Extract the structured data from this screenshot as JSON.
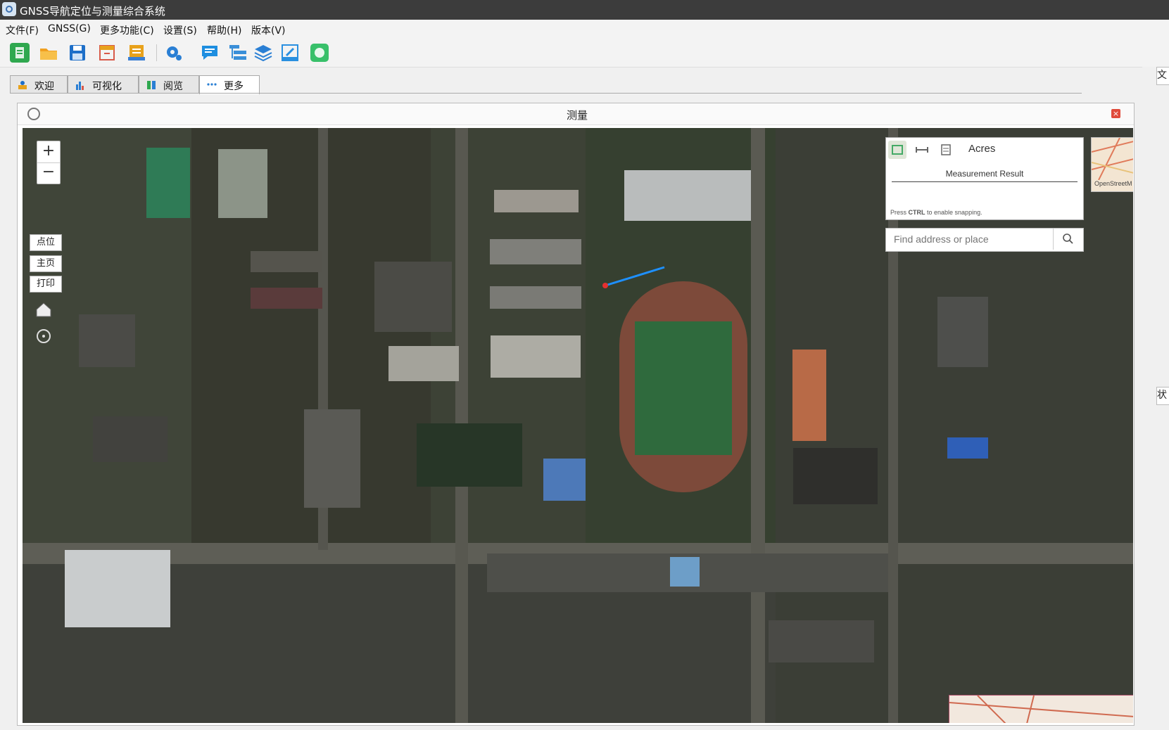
{
  "window": {
    "title": "GNSS导航定位与测量综合系统",
    "icon": "globe-app-icon"
  },
  "menu": [
    "文件(F)",
    "GNSS(G)",
    "更多功能(C)",
    "设置(S)",
    "帮助(H)",
    "版本(V)"
  ],
  "toolbar": {
    "buttons": [
      {
        "name": "new-file-icon",
        "color": "#2fa84f"
      },
      {
        "name": "open-folder-icon",
        "color": "#f0a020"
      },
      {
        "name": "save-icon",
        "color": "#1e6fc8"
      },
      {
        "name": "archive-icon",
        "color": "#d85a4a"
      },
      {
        "name": "report-icon",
        "color": "#e8a21c"
      },
      {
        "name": "settings-gear-icon",
        "color": "#2a7fd4"
      },
      {
        "name": "message-icon",
        "color": "#1e8ee0"
      },
      {
        "name": "tree-list-icon",
        "color": "#3a8fd8"
      },
      {
        "name": "layers-icon",
        "color": "#2a7fd4"
      },
      {
        "name": "link-icon",
        "color": "#2a90e0"
      },
      {
        "name": "chat-bubble-icon",
        "color": "#38c06a"
      }
    ]
  },
  "tabs": [
    {
      "label": "欢迎",
      "icon": "user-icon",
      "active": false
    },
    {
      "label": "可视化",
      "icon": "bar-chart-icon",
      "active": false
    },
    {
      "label": "阅览",
      "icon": "reader-icon",
      "active": false
    },
    {
      "label": "更多",
      "icon": "more-dots-icon",
      "active": true
    }
  ],
  "panel": {
    "title": "测量"
  },
  "map": {
    "zoom_in": "+",
    "zoom_out": "−",
    "buttons": [
      "点位",
      "主页",
      "打印"
    ],
    "measurement": {
      "tools": [
        "area-measure-icon",
        "distance-measure-icon",
        "location-measure-icon"
      ],
      "unit": "Acres",
      "result_label": "Measurement Result",
      "hint_prefix": "Press ",
      "hint_key": "CTRL",
      "hint_suffix": " to enable snapping."
    },
    "search": {
      "placeholder": "Find address or place"
    },
    "basemap_caption": "OpenStreetM"
  },
  "side_tabs": [
    "文",
    "状"
  ]
}
